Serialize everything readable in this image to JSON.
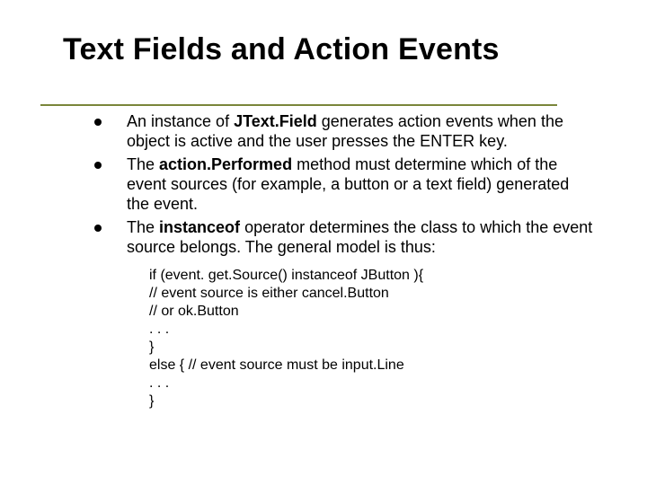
{
  "title": "Text Fields and Action Events",
  "bullets": [
    {
      "pre": "An instance of ",
      "bold": "JText.Field",
      "post": " generates action events when the object is active and the user presses the ENTER key."
    },
    {
      "pre": "The ",
      "bold": "action.Performed",
      "post": " method must determine which of the event sources (for example, a button or a text field) generated the event."
    },
    {
      "pre": "The ",
      "bold": "instanceof",
      "post": " operator determines the class to which the event source belongs. The general model is thus:"
    }
  ],
  "code": [
    "if (event. get.Source() instanceof JButton ){",
    "// event source is either cancel.Button",
    "// or ok.Button",
    ". . .",
    "}",
    "else { // event source must be input.Line",
    ". . .",
    "}"
  ]
}
